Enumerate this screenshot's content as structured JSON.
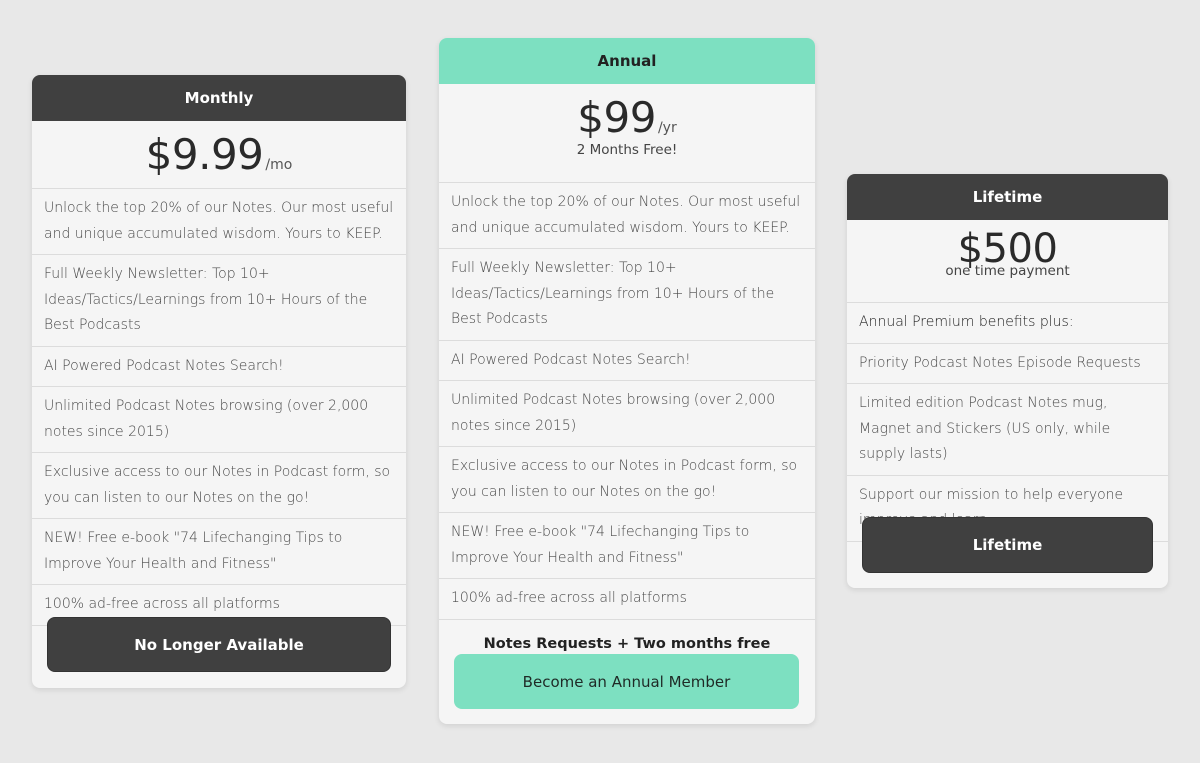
{
  "plans": {
    "monthly": {
      "title": "Monthly",
      "price": "$9.99",
      "period": "/mo",
      "features": [
        "Unlock the top 20% of our Notes. Our most useful and unique accumulated wisdom. Yours to KEEP.",
        "Full Weekly Newsletter: Top 10+ Ideas/Tactics/Learnings from 10+ Hours of the Best Podcasts",
        "AI Powered Podcast Notes Search!",
        "Unlimited Podcast Notes browsing (over 2,000 notes since 2015)",
        "Exclusive access to our Notes in Podcast form, so you can listen to our Notes on the go!",
        "NEW! Free e-book \"74 Lifechanging Tips to Improve Your Health and Fitness\"",
        "100% ad-free across all platforms"
      ],
      "button_label": "No Longer Available"
    },
    "annual": {
      "title": "Annual",
      "price": "$99",
      "period": "/yr",
      "subtitle": "2 Months Free!",
      "features": [
        "Unlock the top 20% of our Notes. Our most useful and unique accumulated wisdom. Yours to KEEP.",
        "Full Weekly Newsletter: Top 10+ Ideas/Tactics/Learnings from 10+ Hours of the Best Podcasts",
        "AI Powered Podcast Notes Search!",
        "Unlimited Podcast Notes browsing (over 2,000 notes since 2015)",
        "Exclusive access to our Notes in Podcast form, so you can listen to our Notes on the go!",
        "NEW! Free e-book \"74 Lifechanging Tips to Improve Your Health and Fitness\"",
        "100% ad-free across all platforms"
      ],
      "extra_note": "Notes Requests + Two months free",
      "button_label": "Become an Annual Member"
    },
    "lifetime": {
      "title": "Lifetime",
      "price": "$500",
      "subtitle": "one time payment",
      "features": [
        "Annual Premium benefits plus:",
        "Priority Podcast Notes Episode Requests",
        "Limited edition Podcast Notes mug, Magnet and Stickers (US only, while supply lasts)",
        "Support our mission to help everyone improve and learn"
      ],
      "button_label": "Lifetime"
    }
  },
  "colors": {
    "accent_mint": "#7de0c1",
    "dark_header": "#404040",
    "background": "#e8e8e8",
    "card": "#f5f5f5"
  }
}
